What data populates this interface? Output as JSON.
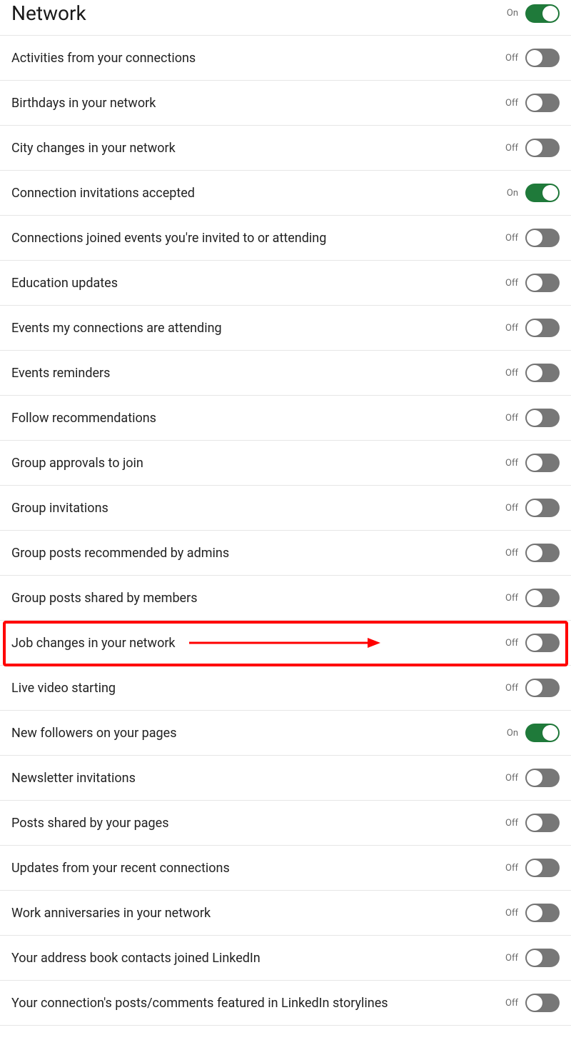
{
  "labels": {
    "on": "On",
    "off": "Off"
  },
  "section": {
    "title": "Network",
    "on": true
  },
  "items": [
    {
      "id": "activities",
      "label": "Activities from your connections",
      "on": false
    },
    {
      "id": "birthdays",
      "label": "Birthdays in your network",
      "on": false
    },
    {
      "id": "city-changes",
      "label": "City changes in your network",
      "on": false
    },
    {
      "id": "conn-invite-accepted",
      "label": "Connection invitations accepted",
      "on": true
    },
    {
      "id": "conn-joined-events",
      "label": "Connections joined events you're invited to or attending",
      "on": false
    },
    {
      "id": "education",
      "label": "Education updates",
      "on": false
    },
    {
      "id": "events-attending",
      "label": "Events my connections are attending",
      "on": false
    },
    {
      "id": "events-reminders",
      "label": "Events reminders",
      "on": false
    },
    {
      "id": "follow-rec",
      "label": "Follow recommendations",
      "on": false
    },
    {
      "id": "group-approvals",
      "label": "Group approvals to join",
      "on": false
    },
    {
      "id": "group-invitations",
      "label": "Group invitations",
      "on": false
    },
    {
      "id": "group-posts-admins",
      "label": "Group posts recommended by admins",
      "on": false
    },
    {
      "id": "group-posts-members",
      "label": "Group posts shared by members",
      "on": false
    },
    {
      "id": "job-changes",
      "label": "Job changes in your network",
      "on": false,
      "highlighted": true
    },
    {
      "id": "live-video",
      "label": "Live video starting",
      "on": false
    },
    {
      "id": "new-followers",
      "label": "New followers on your pages",
      "on": true
    },
    {
      "id": "newsletter",
      "label": "Newsletter invitations",
      "on": false
    },
    {
      "id": "posts-pages",
      "label": "Posts shared by your pages",
      "on": false
    },
    {
      "id": "recent-conn",
      "label": "Updates from your recent connections",
      "on": false
    },
    {
      "id": "work-anniv",
      "label": "Work anniversaries in your network",
      "on": false
    },
    {
      "id": "address-book",
      "label": "Your address book contacts joined LinkedIn",
      "on": false
    },
    {
      "id": "storylines",
      "label": "Your connection's posts/comments featured in LinkedIn storylines",
      "on": false
    }
  ]
}
